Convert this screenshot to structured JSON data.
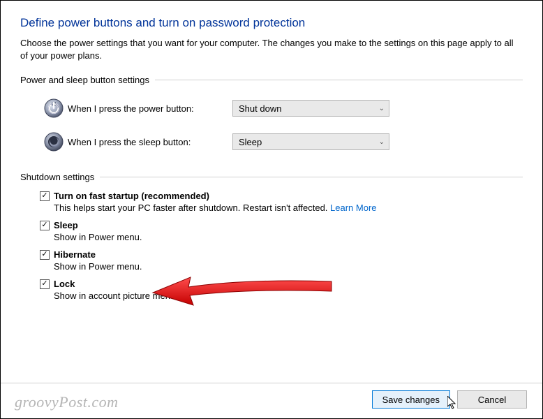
{
  "header": {
    "title": "Define power buttons and turn on password protection",
    "description": "Choose the power settings that you want for your computer. The changes you make to the settings on this page apply to all of your power plans."
  },
  "sections": {
    "power_sleep_label": "Power and sleep button settings",
    "shutdown_label": "Shutdown settings"
  },
  "power_button": {
    "label": "When I press the power button:",
    "value": "Shut down"
  },
  "sleep_button": {
    "label": "When I press the sleep button:",
    "value": "Sleep"
  },
  "shutdown_settings": {
    "fast_startup": {
      "title": "Turn on fast startup (recommended)",
      "desc": "This helps start your PC faster after shutdown. Restart isn't affected. ",
      "link": "Learn More",
      "checked": true
    },
    "sleep": {
      "title": "Sleep",
      "desc": "Show in Power menu.",
      "checked": true
    },
    "hibernate": {
      "title": "Hibernate",
      "desc": "Show in Power menu.",
      "checked": true
    },
    "lock": {
      "title": "Lock",
      "desc": "Show in account picture menu.",
      "checked": true
    }
  },
  "footer": {
    "save": "Save changes",
    "cancel": "Cancel"
  },
  "watermark": "groovyPost.com"
}
